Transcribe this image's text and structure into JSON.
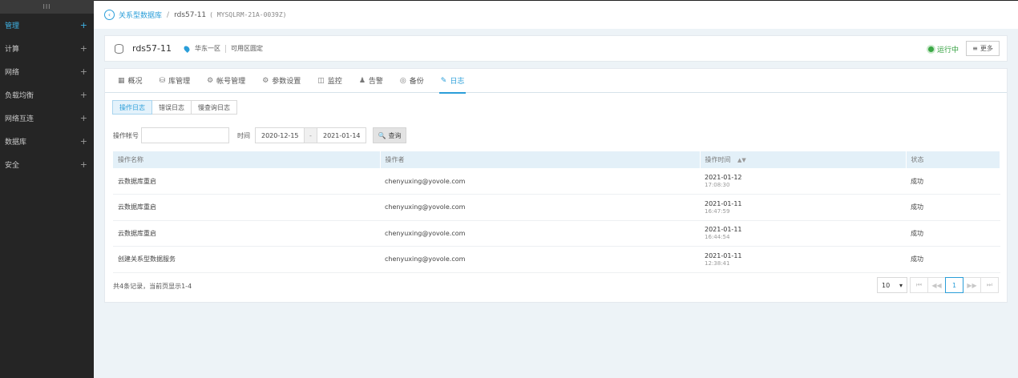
{
  "sidebar": {
    "toggle": "III",
    "items": [
      {
        "label": "管理",
        "active": true
      },
      {
        "label": "计算"
      },
      {
        "label": "网络"
      },
      {
        "label": "负载均衡"
      },
      {
        "label": "网络互连"
      },
      {
        "label": "数据库"
      },
      {
        "label": "安全"
      }
    ],
    "expand_symbol": "+"
  },
  "breadcrumb": {
    "back_icon": "‹",
    "parent": "关系型数据库",
    "separator": "/",
    "current": "rds57-11",
    "instance_id": "( MYSQLRM-21A-0039Z)"
  },
  "instance": {
    "name": "rds57-11",
    "region": "华东一区",
    "zone": "可用区圆定",
    "status": "运行中",
    "more_label": "更多",
    "more_icon": "≡"
  },
  "tabs": [
    {
      "label": "概况",
      "icon": "▦"
    },
    {
      "label": "库管理",
      "icon": "⛁"
    },
    {
      "label": "帐号管理",
      "icon": "⚙"
    },
    {
      "label": "参数设置",
      "icon": "⚙"
    },
    {
      "label": "监控",
      "icon": "◫"
    },
    {
      "label": "告警",
      "icon": "♟"
    },
    {
      "label": "备份",
      "icon": "◎"
    },
    {
      "label": "日志",
      "icon": "✎",
      "active": true
    }
  ],
  "subtabs": [
    {
      "label": "操作日志",
      "active": true
    },
    {
      "label": "错误日志"
    },
    {
      "label": "慢查询日志"
    }
  ],
  "filters": {
    "account_label": "操作帐号",
    "account_value": "",
    "time_label": "时间",
    "start_date": "2020-12-15",
    "range_dash": "-",
    "end_date": "2021-01-14",
    "search_label": "查询",
    "search_icon": "🔍"
  },
  "table": {
    "columns": [
      "操作名称",
      "操作者",
      "操作时间",
      "状态"
    ],
    "sort_icon": "▲▼",
    "rows": [
      {
        "name": "云数据库重启",
        "operator": "chenyuxing@yovole.com",
        "date": "2021-01-12",
        "time": "17:08:30",
        "status": "成功"
      },
      {
        "name": "云数据库重启",
        "operator": "chenyuxing@yovole.com",
        "date": "2021-01-11",
        "time": "16:47:59",
        "status": "成功"
      },
      {
        "name": "云数据库重启",
        "operator": "chenyuxing@yovole.com",
        "date": "2021-01-11",
        "time": "16:44:54",
        "status": "成功"
      },
      {
        "name": "创建关系型数据服务",
        "operator": "chenyuxing@yovole.com",
        "date": "2021-01-11",
        "time": "12:38:41",
        "status": "成功"
      }
    ]
  },
  "footer": {
    "summary": "共4条记录，当前页显示1-4",
    "page_size": "10",
    "page_size_caret": "▾",
    "first": "⏮",
    "prev": "◀◀",
    "current_page": "1",
    "next": "▶▶",
    "last": "⏭"
  },
  "colors": {
    "accent": "#2a9ed9",
    "success": "#2e9e3a",
    "sidebar_bg": "#252525"
  }
}
